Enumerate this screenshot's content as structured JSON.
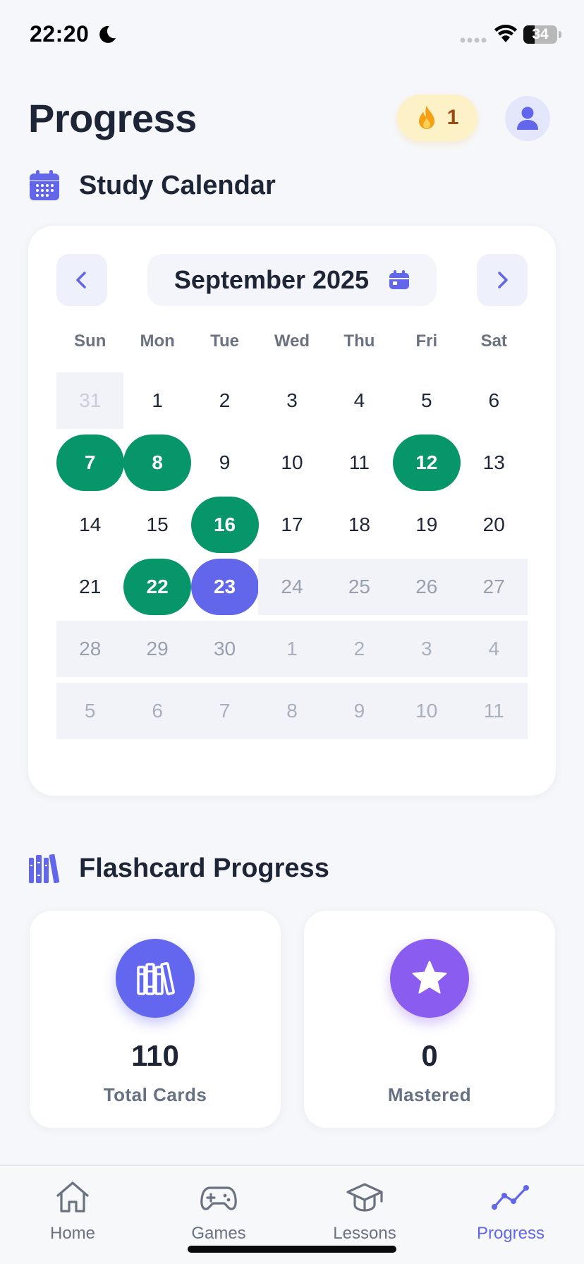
{
  "status_bar": {
    "time": "22:20",
    "battery": "34",
    "battery_level": 0.34
  },
  "header": {
    "title": "Progress",
    "streak_count": "1"
  },
  "calendar_section": {
    "title": "Study Calendar",
    "month_label": "September 2025",
    "weekdays": [
      "Sun",
      "Mon",
      "Tue",
      "Wed",
      "Thu",
      "Fri",
      "Sat"
    ],
    "weeks": [
      [
        {
          "d": "31",
          "s": "other-prev"
        },
        {
          "d": "1",
          "s": "normal"
        },
        {
          "d": "2",
          "s": "normal"
        },
        {
          "d": "3",
          "s": "normal"
        },
        {
          "d": "4",
          "s": "normal"
        },
        {
          "d": "5",
          "s": "normal"
        },
        {
          "d": "6",
          "s": "normal"
        }
      ],
      [
        {
          "d": "7",
          "s": "studied"
        },
        {
          "d": "8",
          "s": "studied"
        },
        {
          "d": "9",
          "s": "normal"
        },
        {
          "d": "10",
          "s": "normal"
        },
        {
          "d": "11",
          "s": "normal"
        },
        {
          "d": "12",
          "s": "studied"
        },
        {
          "d": "13",
          "s": "normal"
        }
      ],
      [
        {
          "d": "14",
          "s": "normal"
        },
        {
          "d": "15",
          "s": "normal"
        },
        {
          "d": "16",
          "s": "studied"
        },
        {
          "d": "17",
          "s": "normal"
        },
        {
          "d": "18",
          "s": "normal"
        },
        {
          "d": "19",
          "s": "normal"
        },
        {
          "d": "20",
          "s": "normal"
        }
      ],
      [
        {
          "d": "21",
          "s": "normal"
        },
        {
          "d": "22",
          "s": "studied"
        },
        {
          "d": "23",
          "s": "today"
        },
        {
          "d": "24",
          "s": "future"
        },
        {
          "d": "25",
          "s": "future"
        },
        {
          "d": "26",
          "s": "future"
        },
        {
          "d": "27",
          "s": "future"
        }
      ],
      [
        {
          "d": "28",
          "s": "future"
        },
        {
          "d": "29",
          "s": "future"
        },
        {
          "d": "30",
          "s": "future"
        },
        {
          "d": "1",
          "s": "other"
        },
        {
          "d": "2",
          "s": "other"
        },
        {
          "d": "3",
          "s": "other"
        },
        {
          "d": "4",
          "s": "other"
        }
      ],
      [
        {
          "d": "5",
          "s": "other"
        },
        {
          "d": "6",
          "s": "other"
        },
        {
          "d": "7",
          "s": "other"
        },
        {
          "d": "8",
          "s": "other"
        },
        {
          "d": "9",
          "s": "other"
        },
        {
          "d": "10",
          "s": "other"
        },
        {
          "d": "11",
          "s": "other"
        }
      ]
    ]
  },
  "flashcard_section": {
    "title": "Flashcard Progress",
    "stats": {
      "total": {
        "value": "110",
        "label": "Total Cards",
        "icon": "books-icon"
      },
      "mastered": {
        "value": "0",
        "label": "Mastered",
        "icon": "star-icon"
      }
    }
  },
  "bottom_nav": {
    "items": [
      {
        "label": "Home",
        "icon": "home-icon"
      },
      {
        "label": "Games",
        "icon": "gamepad-icon"
      },
      {
        "label": "Lessons",
        "icon": "graduation-cap-icon"
      },
      {
        "label": "Progress",
        "icon": "chart-line-icon",
        "active": true
      }
    ]
  },
  "colors": {
    "accent": "#6266ea",
    "studied": "#07956a",
    "mastered": "#8b5cf0",
    "streak_bg": "#fdf1c7"
  }
}
